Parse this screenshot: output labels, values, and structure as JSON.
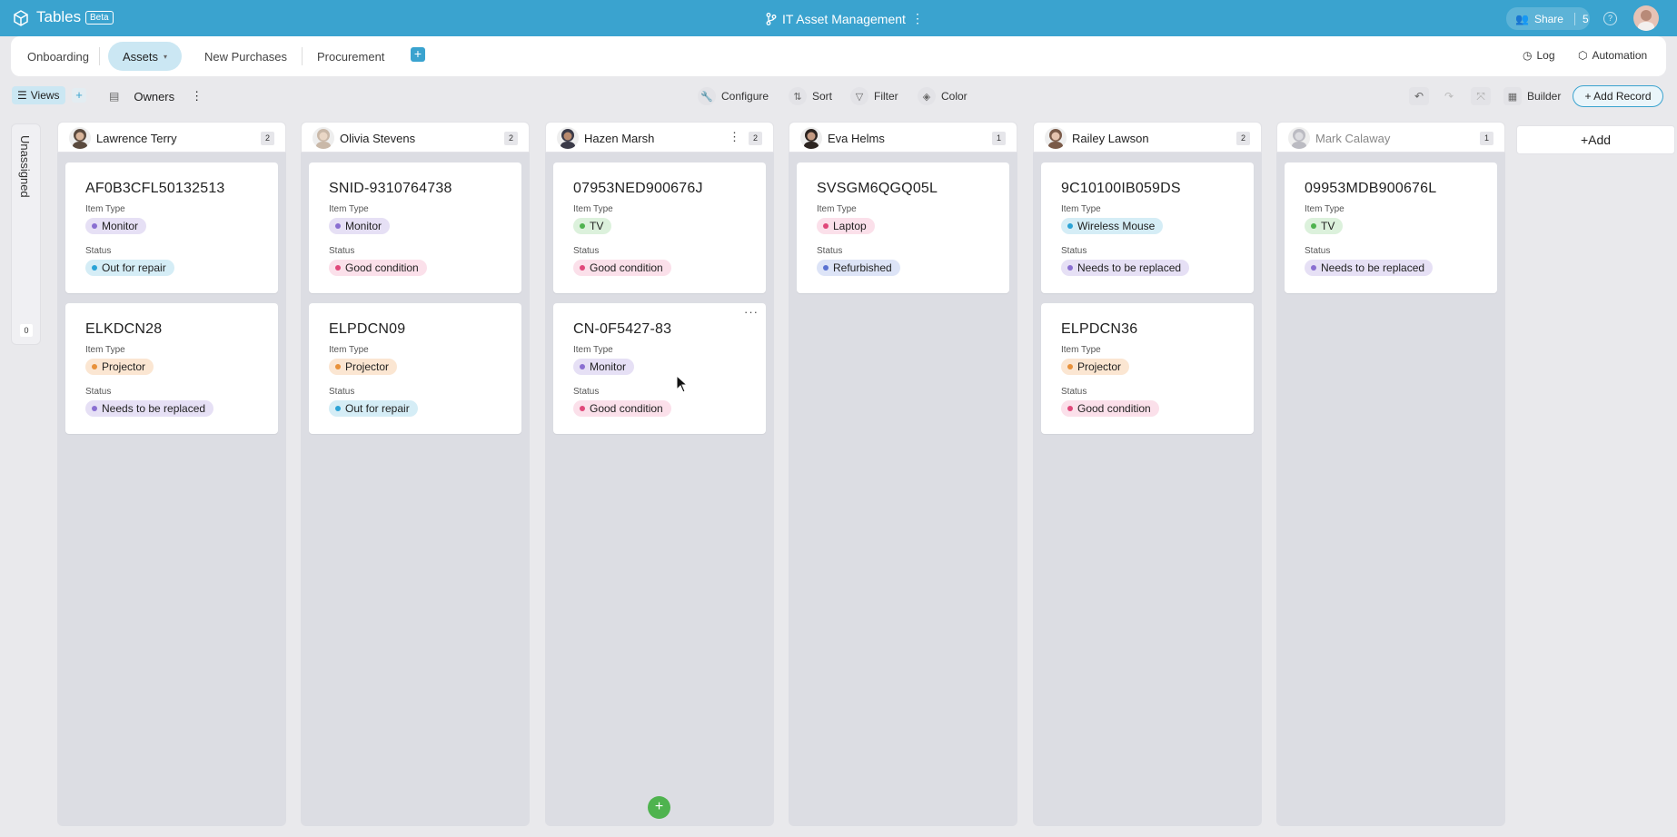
{
  "app": {
    "title": "Tables",
    "badge": "Beta",
    "doc_title": "IT Asset Management",
    "share_label": "Share",
    "share_count": "5",
    "help_icon": "?"
  },
  "tabs": [
    {
      "label": "Onboarding"
    },
    {
      "label": "Assets",
      "active": true
    },
    {
      "label": "New Purchases"
    },
    {
      "label": "Procurement"
    }
  ],
  "tabbar": {
    "log": "Log",
    "automation": "Automation"
  },
  "toolbar": {
    "views": "Views",
    "owners": "Owners",
    "configure": "Configure",
    "sort": "Sort",
    "filter": "Filter",
    "color": "Color",
    "builder": "Builder",
    "add_record": "+ Add Record"
  },
  "board": {
    "unassigned_label": "Unassigned",
    "unassigned_count": "0",
    "add_column": "+Add",
    "columns": [
      {
        "owner": "Lawrence Terry",
        "count": "2",
        "cards": [
          {
            "title": "AF0B3CFL50132513",
            "item_type": "Monitor",
            "status": "Out for repair"
          },
          {
            "title": "ELKDCN28",
            "item_type": "Projector",
            "status": "Needs to be replaced"
          }
        ]
      },
      {
        "owner": "Olivia Stevens",
        "count": "2",
        "cards": [
          {
            "title": "SNID-9310764738",
            "item_type": "Monitor",
            "status": "Good condition"
          },
          {
            "title": "ELPDCN09",
            "item_type": "Projector",
            "status": "Out for repair"
          }
        ]
      },
      {
        "owner": "Hazen Marsh",
        "count": "2",
        "cards": [
          {
            "title": "07953NED900676J",
            "item_type": "TV",
            "status": "Good condition"
          },
          {
            "title": "CN-0F5427-83",
            "item_type": "Monitor",
            "status": "Good condition"
          }
        ]
      },
      {
        "owner": "Eva Helms",
        "count": "1",
        "cards": [
          {
            "title": "SVSGM6QGQ05L",
            "item_type": "Laptop",
            "status": "Refurbished"
          }
        ]
      },
      {
        "owner": "Railey Lawson",
        "count": "2",
        "cards": [
          {
            "title": "9C10100IB059DS",
            "item_type": "Wireless Mouse",
            "status": "Needs to be replaced"
          },
          {
            "title": "ELPDCN36",
            "item_type": "Projector",
            "status": "Good condition"
          }
        ]
      },
      {
        "owner": "Mark Calaway",
        "count": "1",
        "cards": [
          {
            "title": "09953MDB900676L",
            "item_type": "TV",
            "status": "Needs to be replaced"
          }
        ]
      }
    ]
  },
  "field_labels": {
    "item_type": "Item Type",
    "status": "Status"
  },
  "tag_colors": {
    "Monitor": {
      "bg": "#e6e0f5",
      "dot": "#8a6fd1"
    },
    "Projector": {
      "bg": "#fbe6d2",
      "dot": "#e8913a"
    },
    "TV": {
      "bg": "#dcf1dc",
      "dot": "#4fb34f"
    },
    "Laptop": {
      "bg": "#fbe0ea",
      "dot": "#e0487a"
    },
    "Wireless Mouse": {
      "bg": "#d5edf6",
      "dot": "#2ba3d6"
    },
    "Out for repair": {
      "bg": "#d5edf6",
      "dot": "#2ba3d6"
    },
    "Needs to be replaced": {
      "bg": "#e6e0f5",
      "dot": "#8a6fd1"
    },
    "Good condition": {
      "bg": "#fbe0ea",
      "dot": "#e0487a"
    },
    "Refurbished": {
      "bg": "#dde4f7",
      "dot": "#5a72d1"
    }
  },
  "colors": {
    "accent": "#3aa3cf",
    "add_green": "#4fb34f"
  }
}
